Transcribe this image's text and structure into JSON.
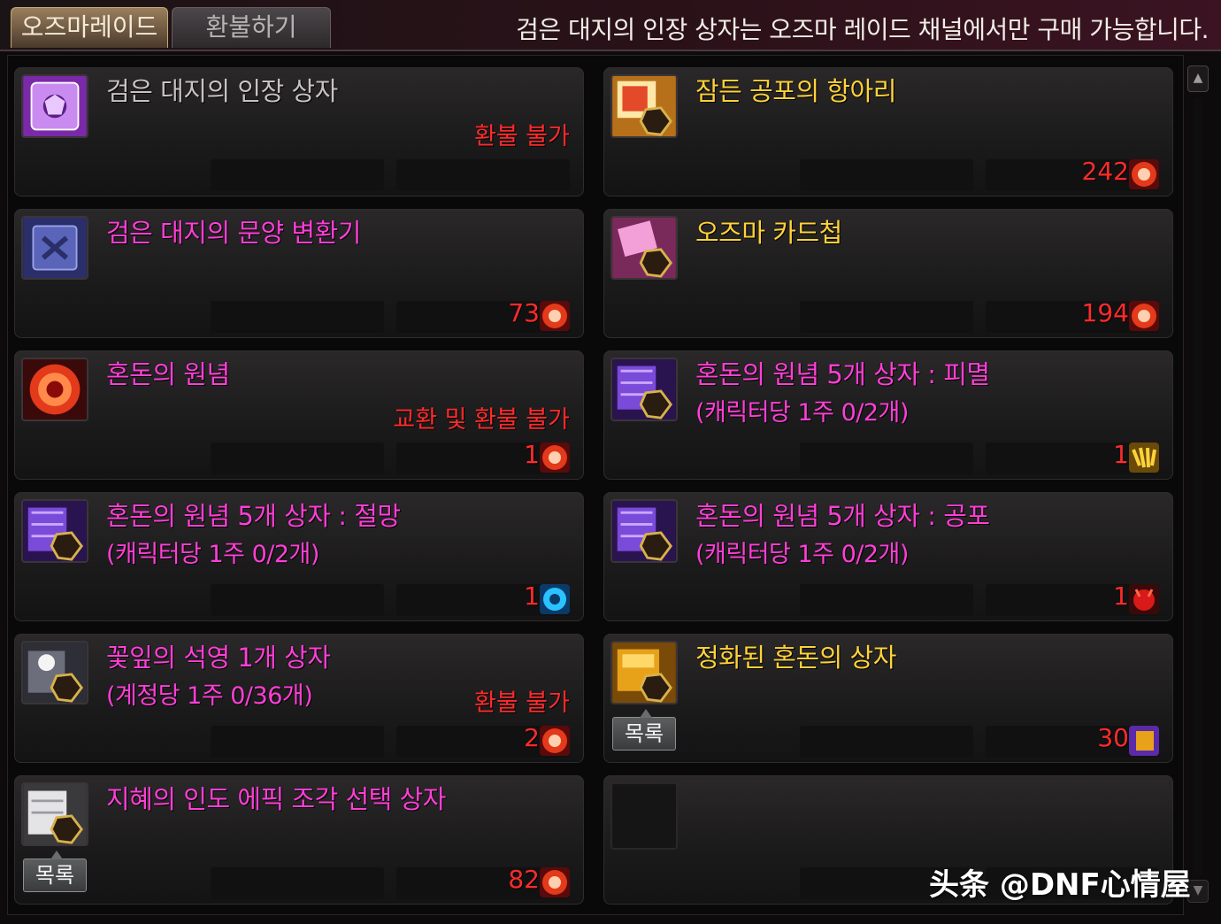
{
  "tabs": [
    {
      "label": "오즈마레이드",
      "active": true
    },
    {
      "label": "환불하기",
      "active": false
    }
  ],
  "notice": "검은 대지의 인장 상자는 오즈마 레이드 채널에서만 구매 가능합니다.",
  "list_button_label": "목록",
  "watermark": "头条 @DNF心情屋",
  "items": [
    {
      "title": "검은 대지의 인장 상자",
      "title_color": "grey",
      "subtitle": "",
      "restriction": "환불 불가",
      "price": "",
      "currency_icon": "",
      "item_icon": "seal-box-icon"
    },
    {
      "title": "잠든 공포의 항아리",
      "title_color": "gold",
      "subtitle": "",
      "restriction": "",
      "price": "242",
      "currency_icon": "red-orb-currency-icon",
      "item_icon": "jar-icon"
    },
    {
      "title": "검은 대지의 문양 변환기",
      "title_color": "pink",
      "subtitle": "",
      "restriction": "",
      "price": "73",
      "currency_icon": "red-orb-currency-icon",
      "item_icon": "pattern-converter-icon"
    },
    {
      "title": "오즈마 카드첩",
      "title_color": "gold",
      "subtitle": "",
      "restriction": "",
      "price": "194",
      "currency_icon": "red-orb-currency-icon",
      "item_icon": "card-album-icon"
    },
    {
      "title": "혼돈의 원념",
      "title_color": "pink",
      "subtitle": "",
      "restriction": "교환 및 환불 불가",
      "price": "1",
      "currency_icon": "red-orb-currency-icon",
      "item_icon": "chaos-orb-icon"
    },
    {
      "title": "혼돈의 원념 5개 상자 : 피멸",
      "title_color": "pink",
      "subtitle": "(캐릭터당 1주 0/2개)",
      "restriction": "",
      "price": "1",
      "currency_icon": "gold-claw-currency-icon",
      "item_icon": "purple-box-icon"
    },
    {
      "title": "혼돈의 원념 5개 상자 : 절망",
      "title_color": "pink",
      "subtitle": "(캐릭터당 1주 0/2개)",
      "restriction": "",
      "price": "1",
      "currency_icon": "blue-orb-currency-icon",
      "item_icon": "purple-box-icon"
    },
    {
      "title": "혼돈의 원념 5개 상자 : 공포",
      "title_color": "pink",
      "subtitle": "(캐릭터당 1주 0/2개)",
      "restriction": "",
      "price": "1",
      "currency_icon": "red-demon-currency-icon",
      "item_icon": "purple-box-icon"
    },
    {
      "title": "꽃잎의 석영 1개 상자",
      "title_color": "pink",
      "subtitle": "(계정당 1주 0/36개)",
      "restriction": "환불 불가",
      "price": "2",
      "currency_icon": "red-orb-currency-icon",
      "item_icon": "petal-box-icon"
    },
    {
      "title": "정화된 혼돈의 상자",
      "title_color": "gold",
      "subtitle": "",
      "restriction": "",
      "price": "30",
      "currency_icon": "purple-gold-currency-icon",
      "item_icon": "gold-box-icon",
      "has_list_button": true
    },
    {
      "title": "지혜의 인도 에픽 조각 선택 상자",
      "title_color": "pink",
      "subtitle": "",
      "restriction": "",
      "price": "82",
      "currency_icon": "red-orb-currency-icon",
      "item_icon": "white-box-icon",
      "has_list_button": true
    },
    {
      "title": "",
      "title_color": "pink",
      "subtitle": "",
      "restriction": "",
      "price": "",
      "currency_icon": "",
      "item_icon": "",
      "empty": true
    }
  ],
  "colors": {
    "pink_title": "#ff3fd7",
    "gold_title": "#ffd23a",
    "grey_title": "#c9c2c3",
    "restriction": "#ff2b2b",
    "price": "#ff2b2b"
  }
}
